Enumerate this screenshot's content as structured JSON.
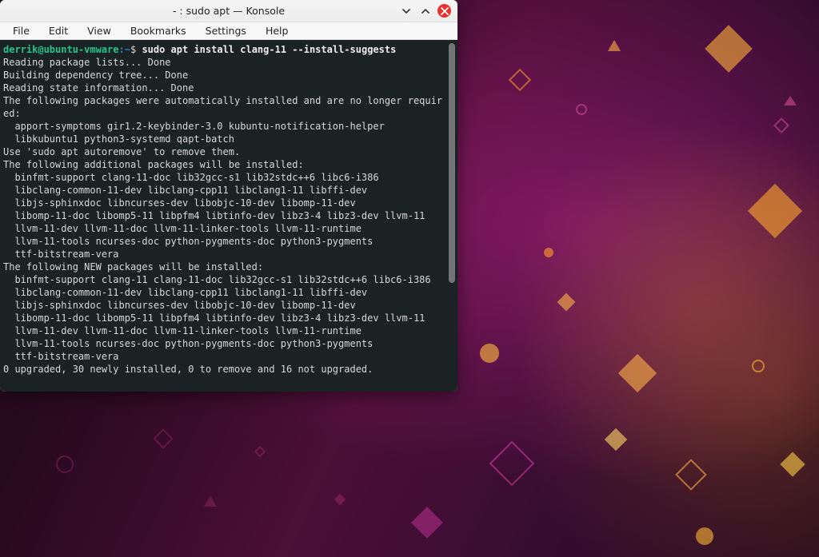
{
  "window": {
    "title": "- : sudo apt — Konsole",
    "menus": [
      "File",
      "Edit",
      "View",
      "Bookmarks",
      "Settings",
      "Help"
    ]
  },
  "terminal": {
    "prompt_user": "derrik@ubuntu-vmware",
    "prompt_path": "~",
    "prompt_suffix": "$",
    "command": "sudo apt install clang-11 --install-suggests",
    "lines": [
      "Reading package lists... Done",
      "Building dependency tree... Done",
      "Reading state information... Done",
      "The following packages were automatically installed and are no longer requir",
      "ed:",
      "  apport-symptoms gir1.2-keybinder-3.0 kubuntu-notification-helper",
      "  libkubuntu1 python3-systemd qapt-batch",
      "Use 'sudo apt autoremove' to remove them.",
      "The following additional packages will be installed:",
      "  binfmt-support clang-11-doc lib32gcc-s1 lib32stdc++6 libc6-i386",
      "  libclang-common-11-dev libclang-cpp11 libclang1-11 libffi-dev",
      "  libjs-sphinxdoc libncurses-dev libobjc-10-dev libomp-11-dev",
      "  libomp-11-doc libomp5-11 libpfm4 libtinfo-dev libz3-4 libz3-dev llvm-11",
      "  llvm-11-dev llvm-11-doc llvm-11-linker-tools llvm-11-runtime",
      "  llvm-11-tools ncurses-doc python-pygments-doc python3-pygments",
      "  ttf-bitstream-vera",
      "The following NEW packages will be installed:",
      "  binfmt-support clang-11 clang-11-doc lib32gcc-s1 lib32stdc++6 libc6-i386",
      "  libclang-common-11-dev libclang-cpp11 libclang1-11 libffi-dev",
      "  libjs-sphinxdoc libncurses-dev libobjc-10-dev libomp-11-dev",
      "  libomp-11-doc libomp5-11 libpfm4 libtinfo-dev libz3-4 libz3-dev llvm-11",
      "  llvm-11-dev llvm-11-doc llvm-11-linker-tools llvm-11-runtime",
      "  llvm-11-tools ncurses-doc python-pygments-doc python3-pygments",
      "  ttf-bitstream-vera",
      "0 upgraded, 30 newly installed, 0 to remove and 16 not upgraded."
    ]
  }
}
